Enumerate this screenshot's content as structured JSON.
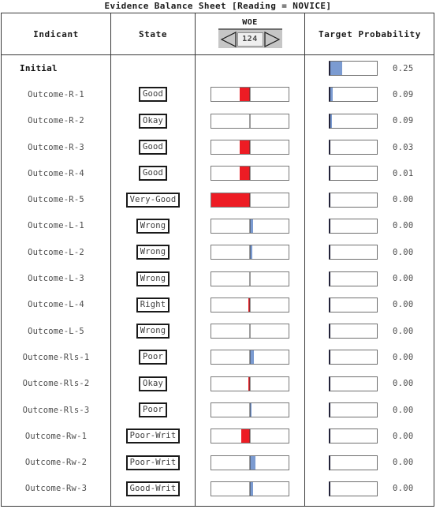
{
  "title": "Evidence Balance Sheet [Reading = NOVICE]",
  "header": {
    "indicant": "Indicant",
    "state": "State",
    "woe": "WOE",
    "woe_value": "124",
    "target_probability": "Target Probability"
  },
  "colors": {
    "red": "#ed1c24",
    "blue": "#7b9bd1",
    "dark_blue_line": "#23233a",
    "border": "#3a3a3a"
  },
  "woe_scale_max": 50,
  "rows": [
    {
      "indicant": "Initial",
      "state": "",
      "woe": 0,
      "probability": "0.25",
      "prob_pct": 25,
      "initial": true
    },
    {
      "indicant": "Outcome-R-1",
      "state": "Good",
      "woe": -13,
      "probability": "0.09",
      "prob_pct": 5,
      "initial": false
    },
    {
      "indicant": "Outcome-R-2",
      "state": "Okay",
      "woe": 0,
      "probability": "0.09",
      "prob_pct": 4,
      "initial": false
    },
    {
      "indicant": "Outcome-R-3",
      "state": "Good",
      "woe": -13,
      "probability": "0.03",
      "prob_pct": 0,
      "initial": false
    },
    {
      "indicant": "Outcome-R-4",
      "state": "Good",
      "woe": -13,
      "probability": "0.01",
      "prob_pct": 0,
      "initial": false
    },
    {
      "indicant": "Outcome-R-5",
      "state": "Very-Good",
      "woe": -50,
      "probability": "0.00",
      "prob_pct": 0,
      "initial": false
    },
    {
      "indicant": "Outcome-L-1",
      "state": "Wrong",
      "woe": 4,
      "probability": "0.00",
      "prob_pct": 0,
      "initial": false
    },
    {
      "indicant": "Outcome-L-2",
      "state": "Wrong",
      "woe": 3,
      "probability": "0.00",
      "prob_pct": 0,
      "initial": false
    },
    {
      "indicant": "Outcome-L-3",
      "state": "Wrong",
      "woe": 0,
      "probability": "0.00",
      "prob_pct": 0,
      "initial": false
    },
    {
      "indicant": "Outcome-L-4",
      "state": "Right",
      "woe": -2,
      "probability": "0.00",
      "prob_pct": 0,
      "initial": false
    },
    {
      "indicant": "Outcome-L-5",
      "state": "Wrong",
      "woe": 0,
      "probability": "0.00",
      "prob_pct": 0,
      "initial": false
    },
    {
      "indicant": "Outcome-Rls-1",
      "state": "Poor",
      "woe": 5,
      "probability": "0.00",
      "prob_pct": 0,
      "initial": false
    },
    {
      "indicant": "Outcome-Rls-2",
      "state": "Okay",
      "woe": -2,
      "probability": "0.00",
      "prob_pct": 0,
      "initial": false
    },
    {
      "indicant": "Outcome-Rls-3",
      "state": "Poor",
      "woe": 2,
      "probability": "0.00",
      "prob_pct": 0,
      "initial": false
    },
    {
      "indicant": "Outcome-Rw-1",
      "state": "Poor-Writ",
      "woe": -11,
      "probability": "0.00",
      "prob_pct": 0,
      "initial": false
    },
    {
      "indicant": "Outcome-Rw-2",
      "state": "Poor-Writ",
      "woe": 7,
      "probability": "0.00",
      "prob_pct": 0,
      "initial": false
    },
    {
      "indicant": "Outcome-Rw-3",
      "state": "Good-Writ",
      "woe": 4,
      "probability": "0.00",
      "prob_pct": 0,
      "initial": false
    }
  ]
}
